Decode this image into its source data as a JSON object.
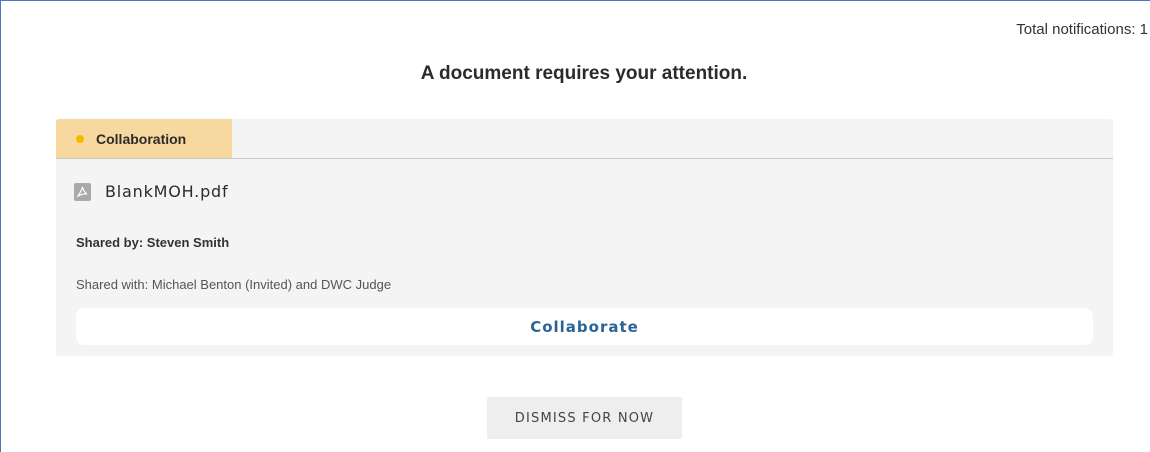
{
  "header": {
    "total_notifications": "Total notifications: 1",
    "title": "A document requires your attention."
  },
  "notification": {
    "tab_label": "Collaboration",
    "tab_dot_color": "#f5b800",
    "tab_bg_color": "#f7d9a0",
    "file_icon": "pdf-file-icon",
    "file_name": "BlankMOH.pdf",
    "shared_by": "Shared by: Steven Smith",
    "shared_with": "Shared with: Michael Benton (Invited) and DWC Judge",
    "action_label": "Collaborate",
    "action_color": "#2a6496"
  },
  "footer": {
    "dismiss_label": "DISMISS FOR NOW"
  }
}
